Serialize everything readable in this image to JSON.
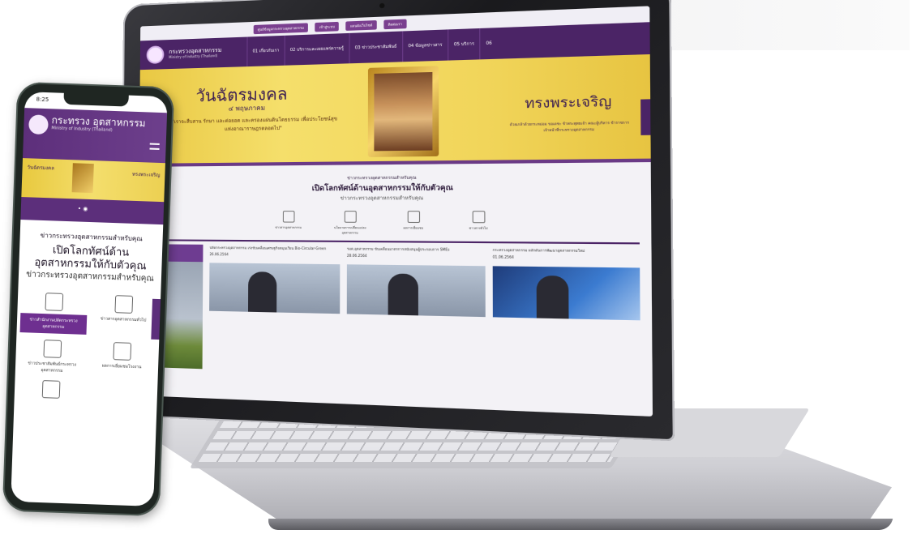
{
  "desktop": {
    "top_buttons": [
      "ศูนย์ข้อมูลกระทรวงอุตสาหกรรม",
      "เข้าสู่ระบบ",
      "แผนผังเว็บไซต์",
      "ติดต่อเรา"
    ],
    "brand_th": "กระทรวงอุตสาหกรรม",
    "brand_en": "Ministry of Industry (Thailand)",
    "menu": [
      "01 เกี่ยวกับเรา",
      "02 บริการและเผยแพร่ความรู้",
      "03 ข่าวประชาสัมพันธ์",
      "04 ข้อมูลข่าวสาร",
      "05 บริการ",
      "06"
    ],
    "banner": {
      "title": "วันฉัตรมงคล",
      "date": "๔ พฤษภาคม",
      "quote": "\"เราจะสืบสาน รักษา และต่อยอด และครองแผ่นดินโดยธรรม เพื่อประโยชน์สุขแห่งอาณาราษฎรตลอดไป\"",
      "right_title": "ทรงพระเจริญ",
      "right_sub": "ด้วยเกล้าด้วยกระหม่อม ขอเดชะ ข้าพระพุทธเจ้า คณะผู้บริหาร ข้าราชการ เจ้าหน้าที่กระทรวงอุตสาหกรรม"
    },
    "section": {
      "kicker": "ข่าวกระทรวงอุตสาหกรรมสำหรับคุณ",
      "headline": "เปิดโลกทัศน์ด้านอุตสาหกรรมให้กับตัวคุณ",
      "sub": "ข่าวกระทรวงอุตสาหกรรมสำหรับคุณ"
    },
    "categories": [
      "ข่าวสารอุตสาหกรรม",
      "นโยบายการเปลี่ยนแปลงอุตสาหกรรม",
      "ผลการเยี่ยมชม",
      "ข่าวสารทั่วไป"
    ],
    "news": [
      {
        "title": "ปลัดกระทรวงอุตสาหกรรม เร่งขับเคลื่อนเศรษฐกิจหมุนเวียน Bio-Circular-Green",
        "date": "26.06.2564"
      },
      {
        "title": "รมต.อุตสาหกรรม ขับเคลื่อนมาตรการสนับสนุนผู้ประกอบการ SMEs",
        "date": "28.06.2564"
      },
      {
        "title": "กระทรวงอุตสาหกรรม ผลักดันการพัฒนาอุตสาหกรรมใหม่",
        "date": "01.06.2564"
      }
    ]
  },
  "mobile": {
    "time": "8:25",
    "brand_th": "กระทรวง อุตสาหกรรม",
    "brand_en": "Ministry of Industry (Thailand)",
    "banner_left": "วันฉัตรมงคล",
    "banner_right": "ทรงพระเจริญ",
    "kicker": "ข่าวกระทรวงอุตสาหกรรมสำหรับคุณ",
    "headline": "เปิดโลกทัศน์ด้าน อุตสาหกรรมให้กับตัวคุณ",
    "sub": "ข่าวกระทรวงอุตสาหกรรมสำหรับคุณ",
    "tiles": [
      {
        "label": "ข่าวสำนักงานปลัดกระทรวงอุตสาหกรรม",
        "icon": "building-icon",
        "active": true
      },
      {
        "label": "ข่าวสารอุตสาหกรรมทั่วไป",
        "icon": "cube-icon"
      },
      {
        "label": "ข่าวประชาสัมพันธ์กระทรวงอุตสาหกรรม",
        "icon": "conveyor-icon"
      },
      {
        "label": "ผลการเยี่ยมชมโรงงาน",
        "icon": "head-gear-icon"
      },
      {
        "label": "",
        "icon": "picture-icon"
      }
    ]
  }
}
